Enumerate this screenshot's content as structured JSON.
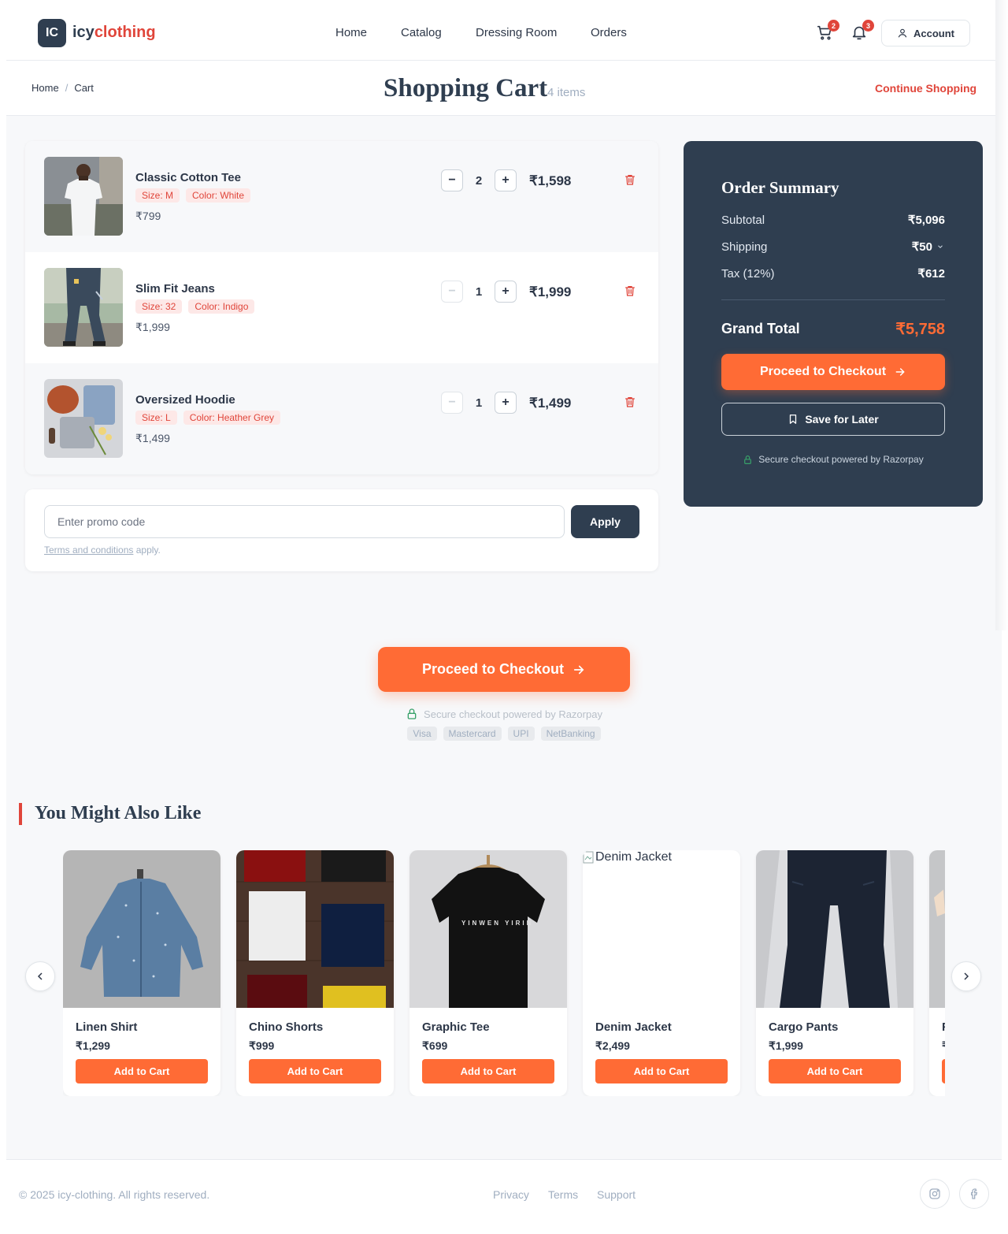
{
  "brand": {
    "logo_initials": "IC",
    "name_part1": "icy",
    "name_part2": "clothing",
    "primary_color": "#2f3e50",
    "accent_color": "#e0453a",
    "cta_color": "#ff6b35"
  },
  "nav": {
    "items": [
      "Home",
      "Catalog",
      "Dressing Room",
      "Orders"
    ]
  },
  "header": {
    "cart_count": "2",
    "notification_count": "3",
    "account_label": "Account"
  },
  "breadcrumb": {
    "home": "Home",
    "current": "Cart"
  },
  "page": {
    "title": "Shopping Cart",
    "item_count": "4 items",
    "continue_label": "Continue Shopping"
  },
  "cart": {
    "items": [
      {
        "name": "Classic Cotton Tee",
        "size": "Size: M",
        "color": "Color: White",
        "unit_price": "₹799",
        "qty": "2",
        "line_total": "₹1,598",
        "minus": "−",
        "plus": "+"
      },
      {
        "name": "Slim Fit Jeans",
        "size": "Size: 32",
        "color": "Color: Indigo",
        "unit_price": "₹1,999",
        "qty": "1",
        "line_total": "₹1,999",
        "minus": "−",
        "plus": "+"
      },
      {
        "name": "Oversized Hoodie",
        "size": "Size: L",
        "color": "Color: Heather Grey",
        "unit_price": "₹1,499",
        "qty": "1",
        "line_total": "₹1,499",
        "minus": "−",
        "plus": "+"
      }
    ]
  },
  "promo": {
    "placeholder": "Enter promo code",
    "apply_label": "Apply",
    "terms_link": "Terms and conditions",
    "terms_suffix": " apply."
  },
  "summary": {
    "title": "Order Summary",
    "subtotal_label": "Subtotal",
    "subtotal": "₹5,096",
    "shipping_label": "Shipping",
    "shipping": "₹50",
    "tax_label": "Tax (12%)",
    "tax": "₹612",
    "grand_label": "Grand Total",
    "grand_total": "₹5,758",
    "checkout_label": "Proceed to Checkout",
    "save_label": "Save for Later",
    "secure_text": "Secure checkout powered by Razorpay"
  },
  "checkout": {
    "label": "Proceed to Checkout",
    "secure_text": "Secure checkout powered by Razorpay",
    "payment_methods": [
      "Visa",
      "Mastercard",
      "UPI",
      "NetBanking"
    ]
  },
  "recommendations": {
    "title": "You Might Also Like",
    "add_label": "Add to Cart",
    "items": [
      {
        "name": "Linen Shirt",
        "price": "₹1,299"
      },
      {
        "name": "Chino Shorts",
        "price": "₹999"
      },
      {
        "name": "Graphic Tee",
        "price": "₹699",
        "print": "YINWEN YIRIN"
      },
      {
        "name": "Denim Jacket",
        "price": "₹2,499",
        "alt": "Denim Jacket"
      },
      {
        "name": "Cargo Pants",
        "price": "₹1,999"
      },
      {
        "name": "F",
        "price": "₹"
      }
    ]
  },
  "footer": {
    "copyright": "© 2025 icy-clothing. All rights reserved.",
    "links": [
      "Privacy",
      "Terms",
      "Support"
    ]
  }
}
